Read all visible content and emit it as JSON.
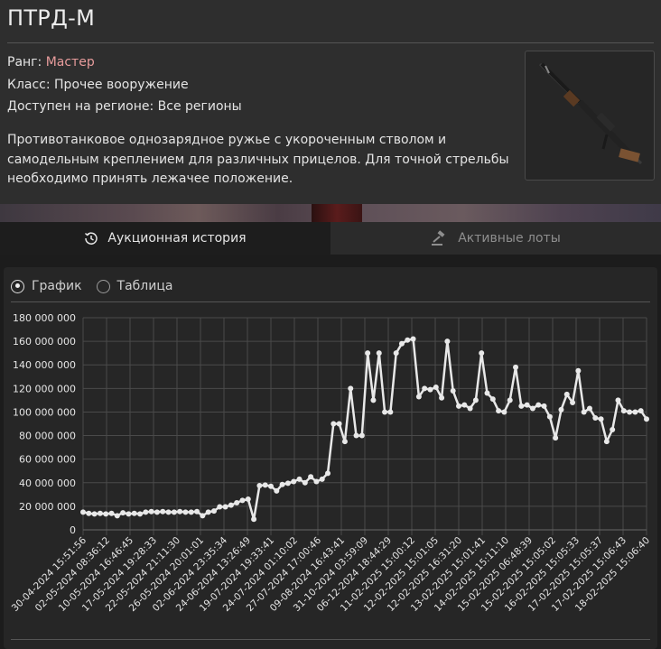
{
  "item": {
    "title": "ПТРД-М",
    "rank_label": "Ранг: ",
    "rank_value": "Мастер",
    "class_line": "Класс: Прочее вооружение",
    "region_line": "Доступен на регионе: Все регионы",
    "description": "Противотанковое однозарядное ружье с укороченным стволом и самодельным креплением для различных прицелов. Для точной стрельбы необходимо принять лежачее положение."
  },
  "tabs": {
    "history": "Аукционная история",
    "active": "Активные лоты"
  },
  "view": {
    "graph": "График",
    "table": "Таблица",
    "selected": "graph"
  },
  "colors": {
    "rank": "#e89c9c",
    "line": "#e8e8e8",
    "grid": "#4a4a4a"
  },
  "chart_data": {
    "type": "line",
    "ylim": [
      0,
      180000000
    ],
    "yticks": [
      "0",
      "20 000 000",
      "40 000 000",
      "60 000 000",
      "80 000 000",
      "100 000 000",
      "120 000 000",
      "140 000 000",
      "160 000 000",
      "180 000 000"
    ],
    "xtick_labels": [
      "30-04-2024 15:51:56",
      "02-05-2024 08:36:12",
      "10-05-2024 16:46:45",
      "17-05-2024 19:28:33",
      "22-05-2024 21:11:30",
      "26-05-2024 20:01:01",
      "02-06-2024 23:35:34",
      "24-06-2024 13:26:49",
      "19-07-2024 19:33:41",
      "24-07-2024 01:10:02",
      "27-07-2024 17:00:46",
      "09-08-2024 16:43:41",
      "31-10-2024 03:59:09",
      "06-12-2024 18:44:29",
      "11-02-2025 15:00:12",
      "12-02-2025 15:01:05",
      "12-02-2025 16:31:20",
      "13-02-2025 15:01:41",
      "14-02-2025 15:11:10",
      "15-02-2025 06:48:39",
      "15-02-2025 15:05:02",
      "16-02-2025 15:05:33",
      "17-02-2025 15:05:37",
      "17-02-2025 15:06:43",
      "18-02-2025 15:06:40"
    ],
    "series": [
      {
        "values": [
          15000000,
          14000000,
          13500000,
          14000000,
          13500000,
          14000000,
          12000000,
          14500000,
          13500000,
          14000000,
          13500000,
          15000000,
          15500000,
          15000000,
          15500000,
          15000000,
          15000000,
          15500000,
          15000000,
          15000000,
          15500000,
          12000000,
          15000000,
          16000000,
          19500000,
          19500000,
          21000000,
          23000000,
          25000000,
          26000000,
          9000000,
          37500000,
          38000000,
          37000000,
          33000000,
          38500000,
          39500000,
          41000000,
          43000000,
          40000000,
          45000000,
          41000000,
          43000000,
          48000000,
          90000000,
          90000000,
          75000000,
          120000000,
          80000000,
          80000000,
          150000000,
          110000000,
          150000000,
          100000000,
          100000000,
          150000000,
          158000000,
          161000000,
          162000000,
          113000000,
          120000000,
          119000000,
          121000000,
          112000000,
          160000000,
          118000000,
          105000000,
          106000000,
          103000000,
          110000000,
          150000000,
          116000000,
          111000000,
          101000000,
          100000000,
          110000000,
          138000000,
          105000000,
          106000000,
          103000000,
          106000000,
          105000000,
          96000000,
          78000000,
          102000000,
          115000000,
          108000000,
          135000000,
          100000000,
          103000000,
          95000000,
          94000000,
          75000000,
          85000000,
          110000000,
          101000000,
          100000000,
          100000000,
          101000000,
          94000000
        ]
      }
    ]
  }
}
